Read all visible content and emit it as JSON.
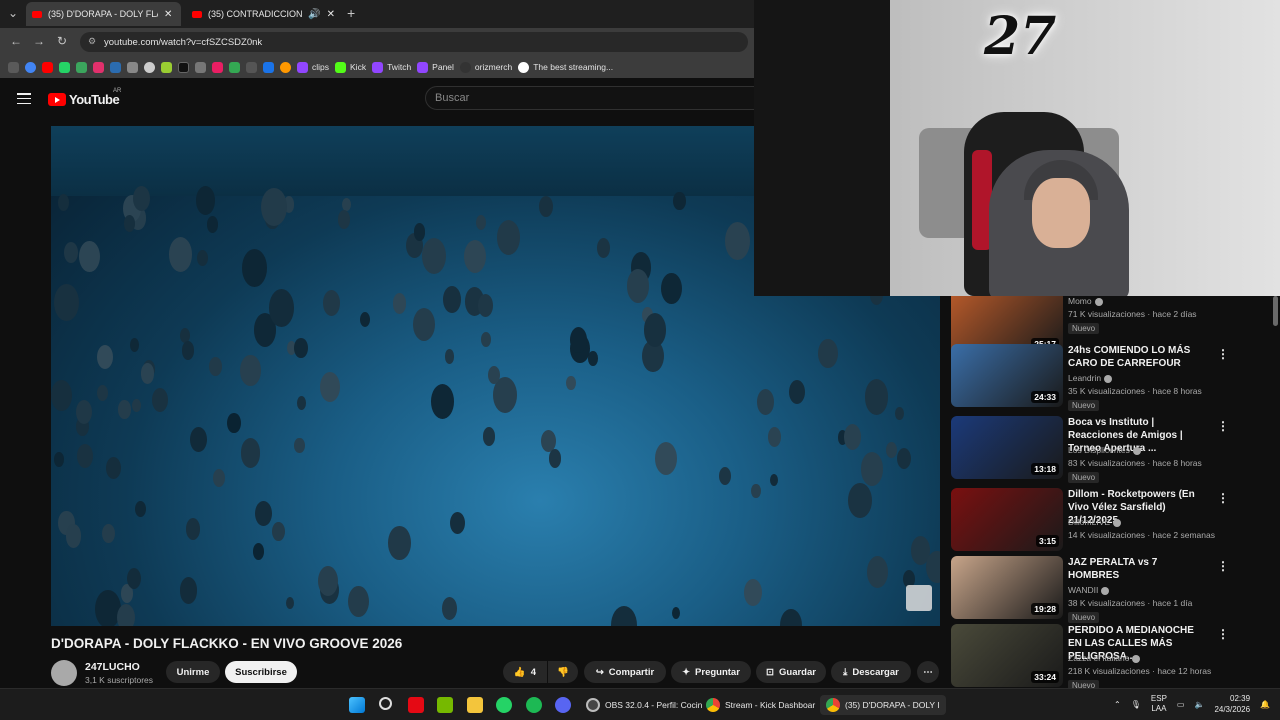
{
  "browser": {
    "tabs": [
      {
        "label": "(35) D'DORAPA - DOLY FLACKKO",
        "active": true
      },
      {
        "label": "(35) CONTRADICCIONES - D",
        "active": false
      }
    ],
    "new_tab": "+",
    "url": "youtube.com/watch?v=cfSZCSDZ0nk",
    "bookmarks": [
      "clips",
      "Kick",
      "Twitch",
      "Panel",
      "orizmerch",
      "The best streaming..."
    ]
  },
  "youtube": {
    "logo": "YouTube",
    "region": "AR",
    "search_placeholder": "Buscar",
    "video": {
      "title": "D'DORAPA - DOLY FLACKKO - EN VIVO GROOVE 2026",
      "channel": "247LUCHO",
      "subscribers": "3,1 K suscriptores",
      "join": "Unirme",
      "subscribe": "Suscribirse",
      "likes": "4",
      "share": "Compartir",
      "ask": "Preguntar",
      "save": "Guardar",
      "download": "Descargar"
    },
    "recommendations": [
      {
        "title": "",
        "channel": "Momo",
        "views": "71 K visualizaciones",
        "age": "hace 2 días",
        "badge": "Nuevo",
        "duration": "25:17",
        "color": "#b85a2a"
      },
      {
        "title": "24hs COMIENDO LO MÁS CARO DE CARREFOUR",
        "channel": "Leandrin",
        "views": "35 K visualizaciones",
        "age": "hace 8 horas",
        "badge": "Nuevo",
        "duration": "24:33",
        "color": "#3a6ea8"
      },
      {
        "title": "Boca vs Instituto | Reacciones de Amigos | Torneo Apertura ...",
        "channel": "Los Displicentes",
        "views": "83 K visualizaciones",
        "age": "hace 8 horas",
        "badge": "Nuevo",
        "duration": "13:18",
        "color": "#1b3a7a"
      },
      {
        "title": "Dillom - Rocketpowers (En Vivo Vélez Sarsfield) 21/12/2025",
        "channel": "DillomLIVE",
        "views": "14 K visualizaciones",
        "age": "hace 2 semanas",
        "badge": "",
        "duration": "3:15",
        "color": "#7a1010"
      },
      {
        "title": "JAZ PERALTA vs 7 HOMBRES",
        "channel": "WANDII",
        "views": "38 K visualizaciones",
        "age": "hace 1 día",
        "badge": "Nuevo",
        "duration": "19:28",
        "color": "#c8a58a"
      },
      {
        "title": "PERDIDO A MEDIANOCHE EN LAS CALLES MÁS PELIGROSA...",
        "channel": "Zazza el italiano",
        "views": "218 K visualizaciones",
        "age": "hace 12 horas",
        "badge": "Nuevo",
        "duration": "33:24",
        "color": "#4a4a3a"
      }
    ],
    "dot": "·"
  },
  "webcam": {
    "logo": "27"
  },
  "taskbar": {
    "apps": [
      {
        "label": "OBS 32.0.4 - Perfil: Cocin",
        "color": "#333"
      },
      {
        "label": "Stream - Kick Dashboar",
        "color": "#3ba55d"
      },
      {
        "label": "(35) D'DORAPA - DOLY I",
        "color": "#e8453c"
      }
    ],
    "lang": [
      "ESP",
      "LAA"
    ],
    "time": "02:39",
    "date": "24/3/2026"
  }
}
